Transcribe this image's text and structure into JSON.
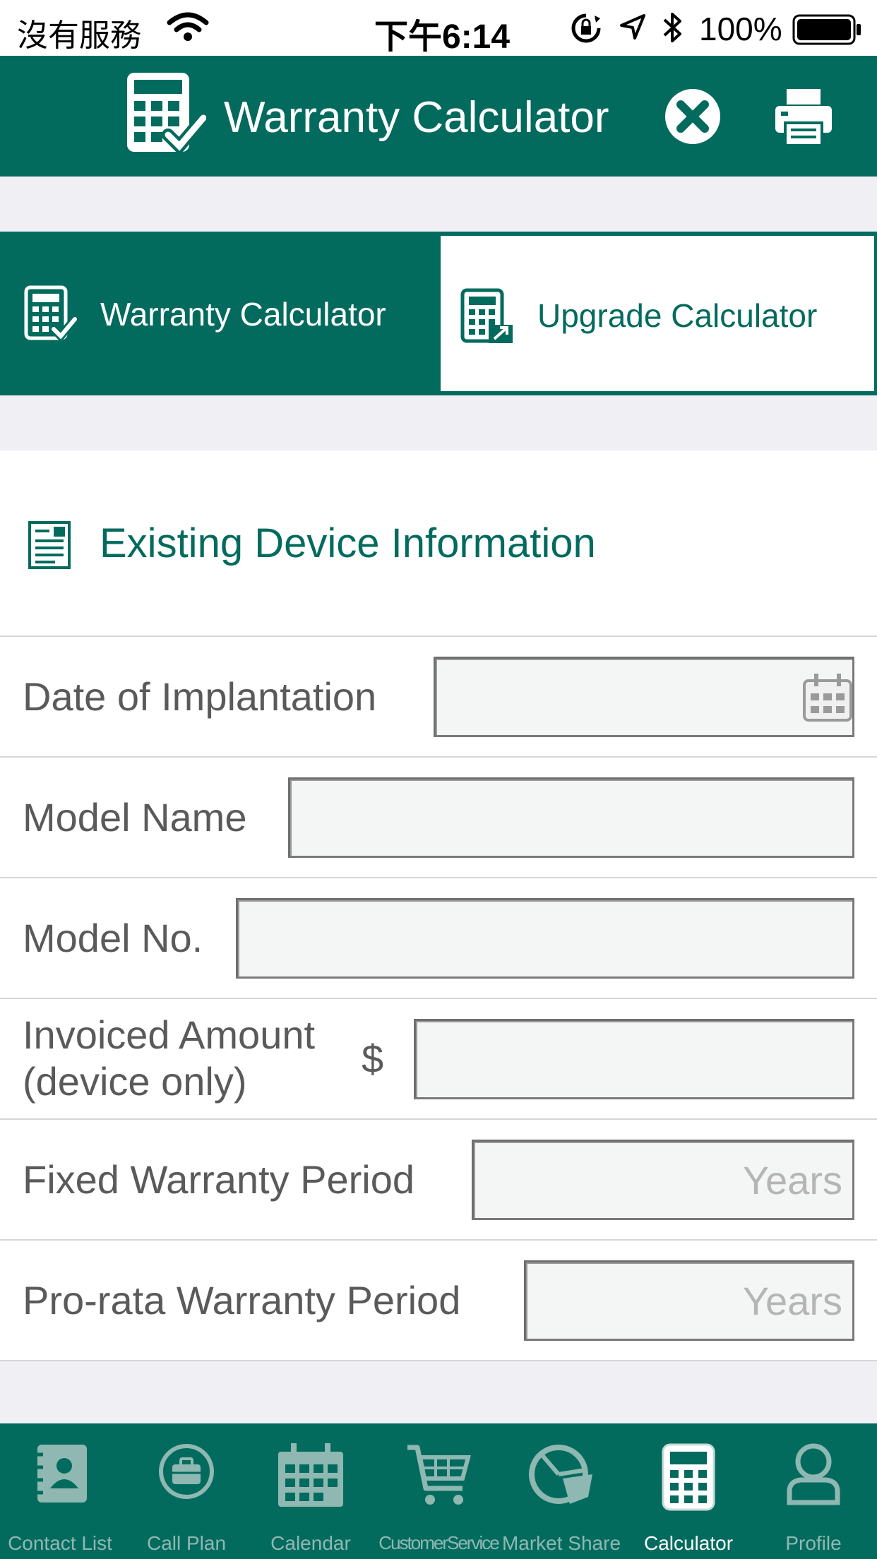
{
  "status_bar": {
    "carrier": "沒有服務",
    "time": "下午6:14",
    "battery_percent": "100%"
  },
  "header": {
    "title": "Warranty Calculator",
    "icons": [
      "calculator-icon",
      "close-icon",
      "printer-icon"
    ]
  },
  "tabs": [
    {
      "label": "Warranty Calculator",
      "selected": true,
      "icon": "calculator-check-icon"
    },
    {
      "label": "Upgrade Calculator",
      "selected": false,
      "icon": "calculator-upgrade-icon"
    }
  ],
  "section": {
    "title": "Existing Device Information",
    "icon": "document-icon"
  },
  "form": {
    "date_of_implantation": {
      "label": "Date of Implantation",
      "value": "",
      "icon": "calendar-icon"
    },
    "model_name": {
      "label": "Model Name",
      "value": ""
    },
    "model_no": {
      "label": "Model No.",
      "value": ""
    },
    "invoiced_amount": {
      "label_line1": "Invoiced Amount",
      "label_line2": "(device only)",
      "currency": "$",
      "value": ""
    },
    "fixed_warranty": {
      "label": "Fixed Warranty Period",
      "placeholder": "Years",
      "value": ""
    },
    "prorata_warranty": {
      "label": "Pro-rata Warranty Period",
      "placeholder": "Years",
      "value": ""
    }
  },
  "tab_bar": [
    {
      "label": "Contact List",
      "icon": "contact-list-icon",
      "active": false
    },
    {
      "label": "Call Plan",
      "icon": "briefcase-icon",
      "active": false
    },
    {
      "label": "Calendar",
      "icon": "calendar-icon",
      "active": false
    },
    {
      "label": "CustomerService",
      "icon": "cart-icon",
      "active": false
    },
    {
      "label": "Market Share",
      "icon": "pie-chart-icon",
      "active": false
    },
    {
      "label": "Calculator",
      "icon": "calculator-icon",
      "active": true
    },
    {
      "label": "Profile",
      "icon": "profile-icon",
      "active": false
    }
  ],
  "colors": {
    "brand": "#036b5e",
    "background_gray": "#efeff4",
    "tab_inactive_text": "#8fb8b2"
  }
}
